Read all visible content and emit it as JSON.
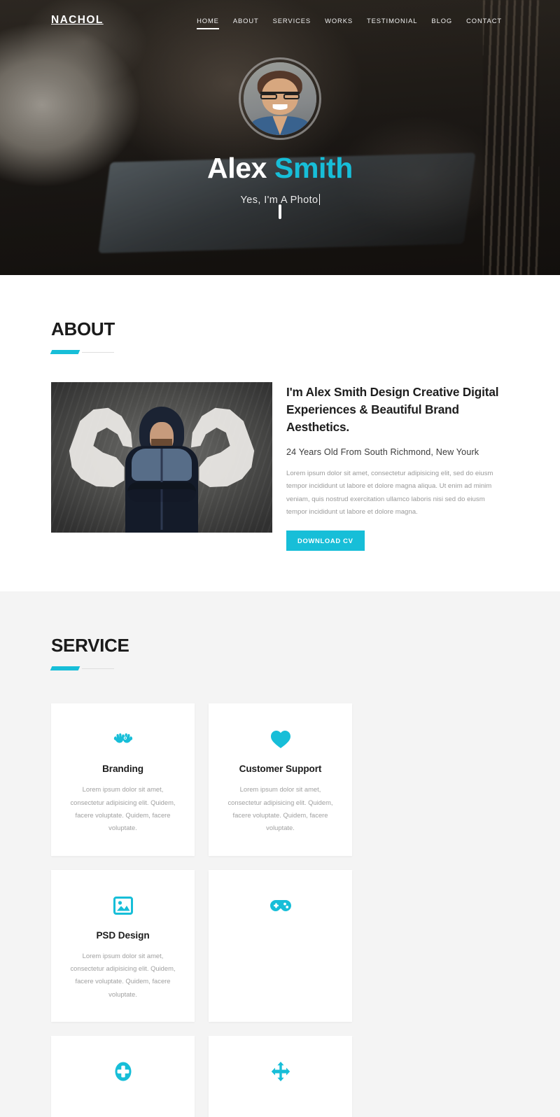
{
  "colors": {
    "accent": "#17bed8",
    "hero_overlay": "#0e0c0b",
    "service_bg": "#f4f4f4",
    "heading": "#1b1b1b",
    "body_text": "#9a9a9a"
  },
  "header": {
    "logo": "NACHOL",
    "nav": [
      {
        "label": "HOME",
        "active": true
      },
      {
        "label": "ABOUT",
        "active": false
      },
      {
        "label": "SERVICES",
        "active": false
      },
      {
        "label": "WORKS",
        "active": false
      },
      {
        "label": "TESTIMONIAL",
        "active": false
      },
      {
        "label": "BLOG",
        "active": false
      },
      {
        "label": "CONTACT",
        "active": false
      }
    ]
  },
  "hero": {
    "avatar_alt": "portrait-photo",
    "name_first": "Alex",
    "name_last": "Smith",
    "subtitle": "Yes, I'm A Photo",
    "scroll_icon": "mouse-scroll-icon"
  },
  "about": {
    "section_title": "ABOUT",
    "image_alt": "man-in-hoodie-chalkboard-muscles",
    "heading": "I'm Alex Smith Design Creative Digital Experiences & Beautiful Brand Aesthetics.",
    "location": "24 Years Old From South Richmond, New Yourk",
    "paragraph": "Lorem ipsum dolor sit amet, consectetur adipisicing elit, sed do eiusm tempor incididunt ut labore et dolore magna aliqua. Ut enim ad minim veniam, quis nostrud exercitation ullamco laboris nisi sed do eiusm tempor incididunt ut labore et dolore magna.",
    "cv_button": "DOWNLOAD CV"
  },
  "service": {
    "section_title": "SERVICE",
    "cards": [
      {
        "icon": "hands-icon",
        "title": "Branding",
        "desc": "Lorem ipsum dolor sit amet, consectetur adipisicing elit. Quidem, facere voluptate. Quidem, facere voluptate."
      },
      {
        "icon": "heart-icon",
        "title": "Customer Support",
        "desc": "Lorem ipsum dolor sit amet, consectetur adipisicing elit. Quidem, facere voluptate. Quidem, facere voluptate."
      },
      {
        "icon": "image-icon",
        "title": "PSD Design",
        "desc": "Lorem ipsum dolor sit amet, consectetur adipisicing elit. Quidem, facere voluptate. Quidem, facere voluptate."
      },
      {
        "icon": "gamepad-icon",
        "title": "",
        "desc": ""
      },
      {
        "icon": "plus-circle-icon",
        "title": "",
        "desc": ""
      },
      {
        "icon": "arrows-move-icon",
        "title": "",
        "desc": ""
      }
    ]
  }
}
